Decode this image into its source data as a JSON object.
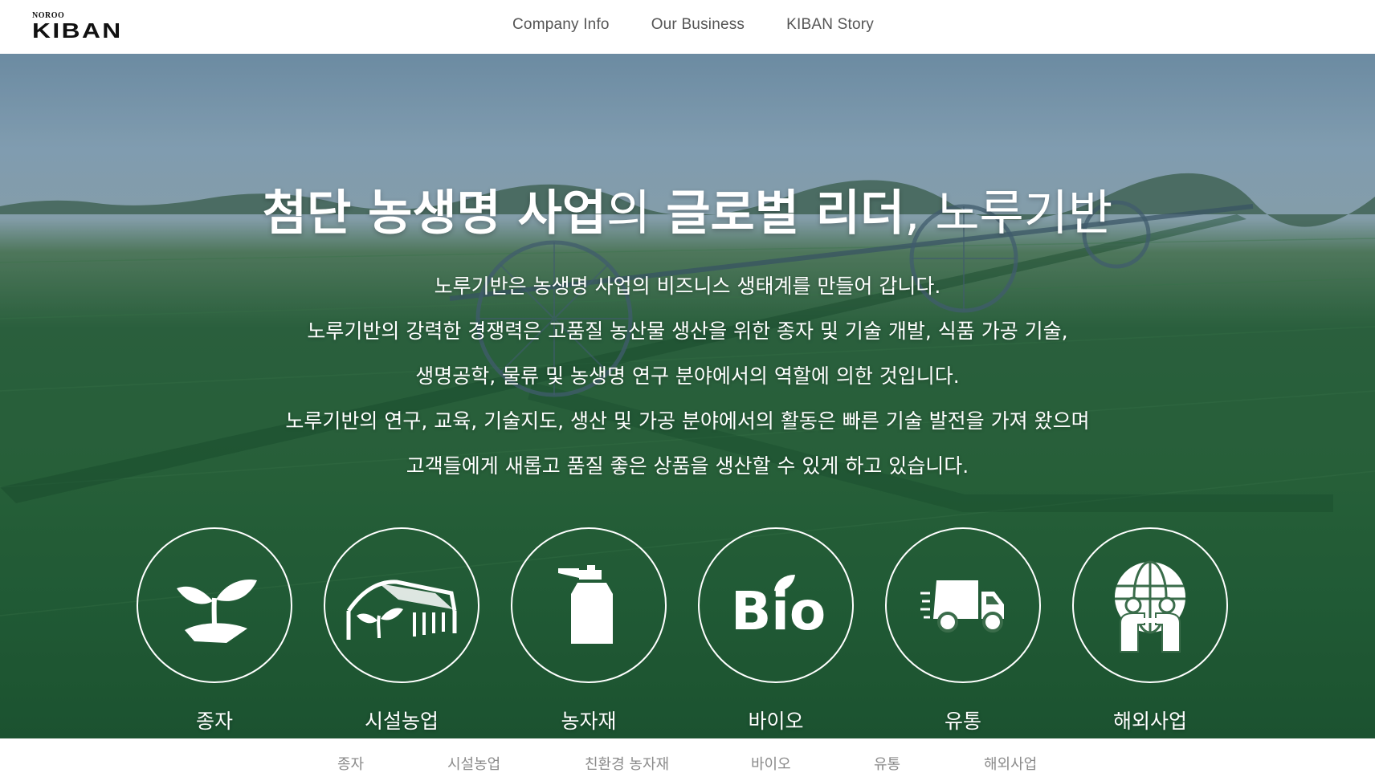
{
  "header": {
    "logo_small": "NOROO",
    "logo_main": "KIBAN",
    "nav": [
      "Company Info",
      "Our Business",
      "KIBAN Story"
    ]
  },
  "hero": {
    "title_part1": "첨단 농생명 사업",
    "title_part2": "의 ",
    "title_part3": "글로벌 리더",
    "title_part4": ", 노루기반",
    "paragraphs": [
      "노루기반은 농생명 사업의 비즈니스 생태계를 만들어 갑니다.",
      "노루기반의 강력한 경쟁력은 고품질 농산물 생산을 위한 종자 및 기술 개발, 식품 가공 기술,",
      "생명공학, 물류 및 농생명 연구 분야에서의 역할에 의한 것입니다.",
      "노루기반의 연구, 교육, 기술지도, 생산 및 가공 분야에서의 활동은 빠른 기술 발전을 가져 왔으며",
      "고객들에게 새롭고 품질 좋은 상품을 생산할 수 있게 하고 있습니다."
    ],
    "businesses": [
      {
        "label": "종자",
        "icon": "sprout-icon"
      },
      {
        "label": "시설농업",
        "icon": "greenhouse-icon"
      },
      {
        "label": "농자재",
        "icon": "sprayer-icon"
      },
      {
        "label": "바이오",
        "icon": "bio-icon",
        "icon_text": "Bio"
      },
      {
        "label": "유통",
        "icon": "truck-icon"
      },
      {
        "label": "해외사업",
        "icon": "globe-people-icon"
      }
    ]
  },
  "subnav": [
    "종자",
    "시설농업",
    "친환경 농자재",
    "바이오",
    "유통",
    "해외사업"
  ],
  "colors": {
    "header_bg": "#ffffff",
    "nav_text": "#555555",
    "hero_text": "#ffffff",
    "subnav_text": "#8a8a8a",
    "field_green": "#2b6a36",
    "sky": "#98b4c7"
  }
}
